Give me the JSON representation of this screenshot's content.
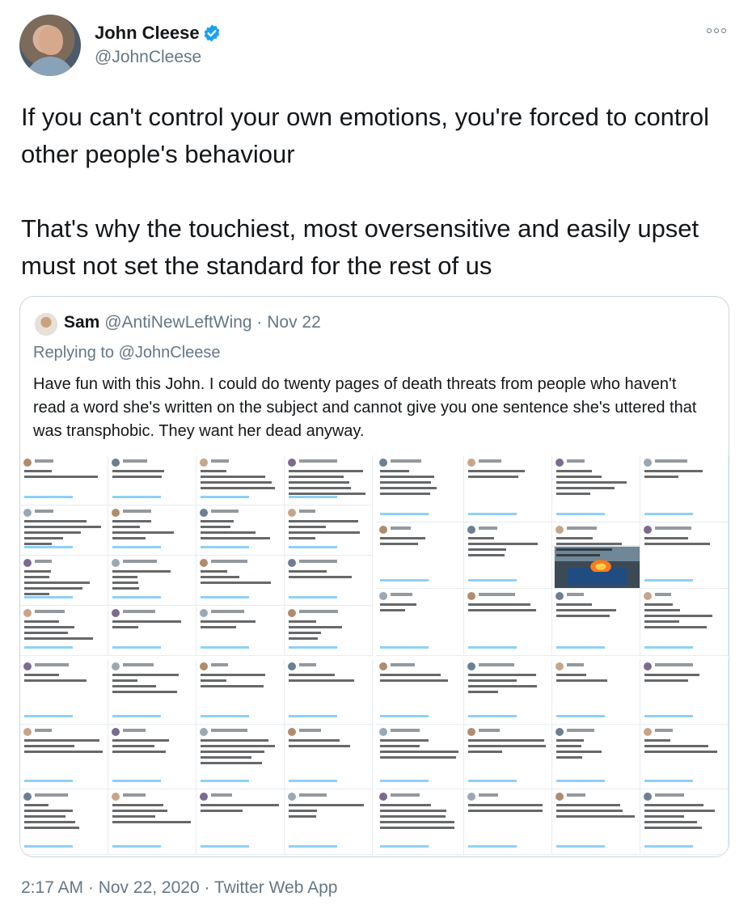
{
  "author": {
    "name": "John Cleese",
    "handle": "@JohnCleese",
    "avatar_icon": "avatar-photo-icon",
    "verified_icon": "verified-badge-icon"
  },
  "tweet": {
    "paragraphs": [
      "If you can't control your own emotions, you're forced to control other people's behaviour",
      "That's why the touchiest, most oversensitive and easily upset must not set the standard for the rest of us"
    ]
  },
  "quoted_tweet": {
    "name": "Sam",
    "handle_and_date": "@AntiNewLeftWing · Nov 22",
    "replying_to_prefix": "Replying to ",
    "replying_to_handle": "@JohnCleese",
    "text": "Have fun with this John. I could do twenty pages of death threats from people who haven't read a word she's written on the subject and cannot give you one sentence she's uttered that was transphobic. They want her dead anyway.",
    "images_description_icon": "screenshot-collage-icon"
  },
  "footer": {
    "timestamp": "2:17 AM · Nov 22, 2020 · Twitter Web App"
  },
  "colors": {
    "text_primary": "#14171a",
    "text_secondary": "#657786",
    "verified_blue": "#1da1f2",
    "border": "#ccd6dd"
  }
}
